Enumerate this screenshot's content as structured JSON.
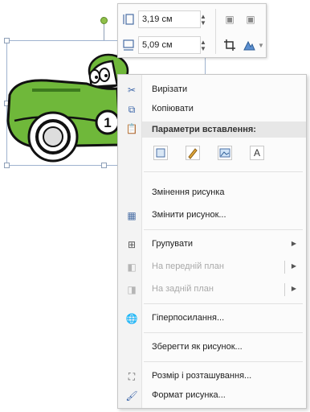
{
  "mini_toolbar": {
    "height_value": "3,19 см",
    "width_value": "5,09 см"
  },
  "context_menu": {
    "cut": "Вирізати",
    "copy": "Копіювати",
    "paste_options_header": "Параметри вставлення:",
    "paste_text_option": "A",
    "change_picture_header": "Змінення рисунка",
    "change_picture": "Змінити рисунок...",
    "group": "Групувати",
    "bring_to_front": "На передній план",
    "send_to_back": "На задній план",
    "hyperlink": "Гіперпосилання...",
    "save_as_picture": "Зберегти як рисунок...",
    "size_and_position": "Розмір і розташування...",
    "format_picture": "Формат рисунка..."
  },
  "colors": {
    "car_green": "#6fb83a",
    "car_dark_green": "#3d7a1e",
    "selection_border": "#9fb3cf",
    "menu_background": "#fbfbfb",
    "menu_header": "#e7e7e7"
  },
  "car_number": "1"
}
